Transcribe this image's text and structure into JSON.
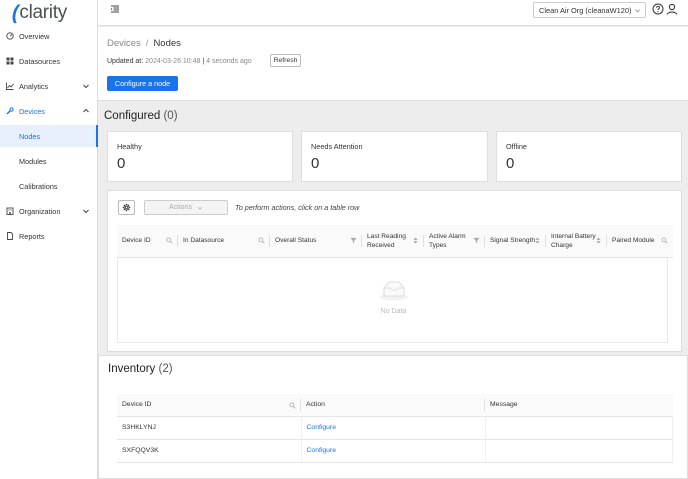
{
  "app": {
    "logo_text": "clarity"
  },
  "sidebar": {
    "items": [
      {
        "label": "Overview",
        "icon": "dashboard-icon"
      },
      {
        "label": "Datasources",
        "icon": "grid-icon"
      },
      {
        "label": "Analytics",
        "icon": "chart-icon"
      },
      {
        "label": "Devices",
        "icon": "wrench-icon"
      },
      {
        "label": "Nodes"
      },
      {
        "label": "Modules"
      },
      {
        "label": "Calibrations"
      },
      {
        "label": "Organization",
        "icon": "organization-icon"
      },
      {
        "label": "Reports",
        "icon": "document-icon"
      }
    ]
  },
  "topbar": {
    "org_selected": "Clean Air Org (cleanaW120)"
  },
  "header": {
    "breadcrumb_parent": "Devices",
    "breadcrumb_separator": "/",
    "breadcrumb_current": "Nodes",
    "updated_label": "Updated at:",
    "updated_value": "2024-03-26 10:48",
    "updated_relative": "4 seconds ago",
    "refresh_label": "Refresh",
    "configure_label": "Configure a node"
  },
  "configured": {
    "title": "Configured",
    "count": "(0)",
    "cards": [
      {
        "label": "Healthy",
        "value": "0"
      },
      {
        "label": "Needs Attention",
        "value": "0"
      },
      {
        "label": "Offline",
        "value": "0"
      }
    ],
    "actions_label": "Actions",
    "hint": "To perform actions, click on a table row",
    "columns": [
      "Device ID",
      "In Datasource",
      "Overall Status",
      "Last Reading Received",
      "Active Alarm Types",
      "Signal Strength",
      "Internal Battery Charge",
      "Paired Module"
    ],
    "empty_text": "No Data"
  },
  "inventory": {
    "title": "Inventory",
    "count": "(2)",
    "columns": [
      "Device ID",
      "Action",
      "Message"
    ],
    "rows": [
      {
        "device_id": "S3HKLYNJ",
        "action": "Configure",
        "message": ""
      },
      {
        "device_id": "SXFQQV3K",
        "action": "Configure",
        "message": ""
      }
    ]
  },
  "colors": {
    "accent": "#1a73e8",
    "selected_bg": "#e8f0fe"
  }
}
